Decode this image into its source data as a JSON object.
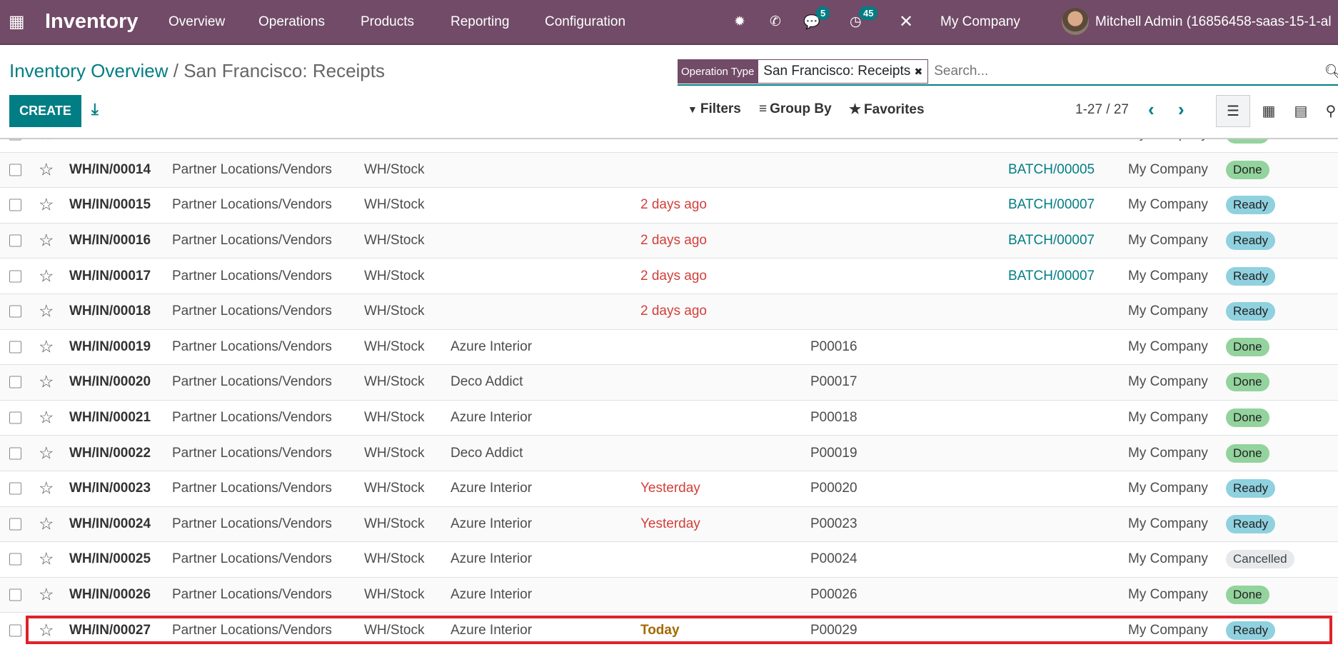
{
  "navbar": {
    "app": "Inventory",
    "menu": [
      "Overview",
      "Operations",
      "Products",
      "Reporting",
      "Configuration"
    ],
    "chat_badge": "5",
    "activity_badge": "45",
    "company": "My Company",
    "user": "Mitchell Admin (16856458-saas-15-1-al",
    "accent": "#714b67"
  },
  "breadcrumb": {
    "parent": "Inventory Overview",
    "sep": " / ",
    "current": "San Francisco: Receipts"
  },
  "search": {
    "facet_label": "Operation Type",
    "facet_value": "San Francisco: Receipts",
    "facet_remove": "✖",
    "placeholder": "Search..."
  },
  "toolbar": {
    "create": "CREATE",
    "filters": "Filters",
    "group_by": "Group By",
    "favorites": "Favorites",
    "pager": "1-27 / 27"
  },
  "rows": [
    {
      "ref": "",
      "from": "",
      "to": "",
      "contact": "",
      "date": "",
      "date_type": "",
      "src": "",
      "batch": "",
      "company": "My Company",
      "status": "Done",
      "status_type": "done"
    },
    {
      "ref": "WH/IN/00014",
      "from": "Partner Locations/Vendors",
      "to": "WH/Stock",
      "contact": "",
      "date": "",
      "date_type": "",
      "src": "",
      "batch": "BATCH/00005",
      "company": "My Company",
      "status": "Done",
      "status_type": "done"
    },
    {
      "ref": "WH/IN/00015",
      "from": "Partner Locations/Vendors",
      "to": "WH/Stock",
      "contact": "",
      "date": "2 days ago",
      "date_type": "late",
      "src": "",
      "batch": "BATCH/00007",
      "company": "My Company",
      "status": "Ready",
      "status_type": "ready"
    },
    {
      "ref": "WH/IN/00016",
      "from": "Partner Locations/Vendors",
      "to": "WH/Stock",
      "contact": "",
      "date": "2 days ago",
      "date_type": "late",
      "src": "",
      "batch": "BATCH/00007",
      "company": "My Company",
      "status": "Ready",
      "status_type": "ready"
    },
    {
      "ref": "WH/IN/00017",
      "from": "Partner Locations/Vendors",
      "to": "WH/Stock",
      "contact": "",
      "date": "2 days ago",
      "date_type": "late",
      "src": "",
      "batch": "BATCH/00007",
      "company": "My Company",
      "status": "Ready",
      "status_type": "ready"
    },
    {
      "ref": "WH/IN/00018",
      "from": "Partner Locations/Vendors",
      "to": "WH/Stock",
      "contact": "",
      "date": "2 days ago",
      "date_type": "late",
      "src": "",
      "batch": "",
      "company": "My Company",
      "status": "Ready",
      "status_type": "ready"
    },
    {
      "ref": "WH/IN/00019",
      "from": "Partner Locations/Vendors",
      "to": "WH/Stock",
      "contact": "Azure Interior",
      "date": "",
      "date_type": "",
      "src": "P00016",
      "batch": "",
      "company": "My Company",
      "status": "Done",
      "status_type": "done"
    },
    {
      "ref": "WH/IN/00020",
      "from": "Partner Locations/Vendors",
      "to": "WH/Stock",
      "contact": "Deco Addict",
      "date": "",
      "date_type": "",
      "src": "P00017",
      "batch": "",
      "company": "My Company",
      "status": "Done",
      "status_type": "done"
    },
    {
      "ref": "WH/IN/00021",
      "from": "Partner Locations/Vendors",
      "to": "WH/Stock",
      "contact": "Azure Interior",
      "date": "",
      "date_type": "",
      "src": "P00018",
      "batch": "",
      "company": "My Company",
      "status": "Done",
      "status_type": "done"
    },
    {
      "ref": "WH/IN/00022",
      "from": "Partner Locations/Vendors",
      "to": "WH/Stock",
      "contact": "Deco Addict",
      "date": "",
      "date_type": "",
      "src": "P00019",
      "batch": "",
      "company": "My Company",
      "status": "Done",
      "status_type": "done"
    },
    {
      "ref": "WH/IN/00023",
      "from": "Partner Locations/Vendors",
      "to": "WH/Stock",
      "contact": "Azure Interior",
      "date": "Yesterday",
      "date_type": "late",
      "src": "P00020",
      "batch": "",
      "company": "My Company",
      "status": "Ready",
      "status_type": "ready"
    },
    {
      "ref": "WH/IN/00024",
      "from": "Partner Locations/Vendors",
      "to": "WH/Stock",
      "contact": "Azure Interior",
      "date": "Yesterday",
      "date_type": "late",
      "src": "P00023",
      "batch": "",
      "company": "My Company",
      "status": "Ready",
      "status_type": "ready"
    },
    {
      "ref": "WH/IN/00025",
      "from": "Partner Locations/Vendors",
      "to": "WH/Stock",
      "contact": "Azure Interior",
      "date": "",
      "date_type": "",
      "src": "P00024",
      "batch": "",
      "company": "My Company",
      "status": "Cancelled",
      "status_type": "cancelled"
    },
    {
      "ref": "WH/IN/00026",
      "from": "Partner Locations/Vendors",
      "to": "WH/Stock",
      "contact": "Azure Interior",
      "date": "",
      "date_type": "",
      "src": "P00026",
      "batch": "",
      "company": "My Company",
      "status": "Done",
      "status_type": "done"
    },
    {
      "ref": "WH/IN/00027",
      "from": "Partner Locations/Vendors",
      "to": "WH/Stock",
      "contact": "Azure Interior",
      "date": "Today",
      "date_type": "today",
      "src": "P00029",
      "batch": "",
      "company": "My Company",
      "status": "Ready",
      "status_type": "ready"
    }
  ],
  "highlight_color": "#e0222a"
}
